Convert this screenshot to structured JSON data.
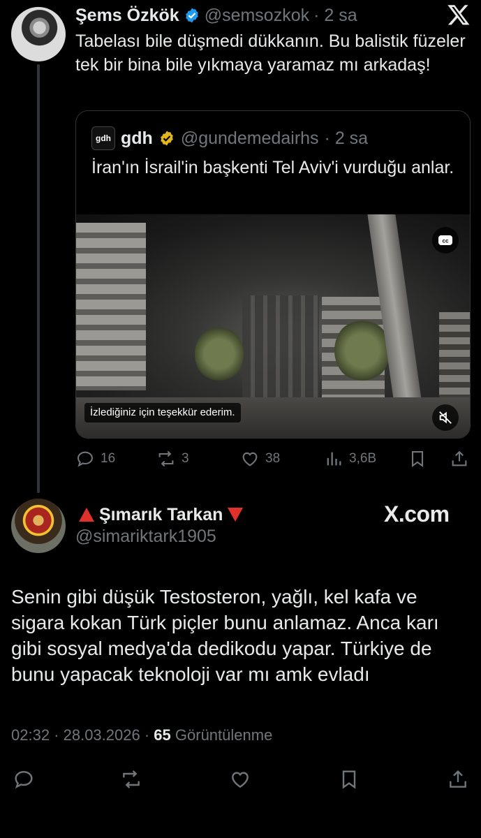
{
  "tweet1": {
    "name": "Şems Özkök",
    "handle": "@semsozkok",
    "time": "· 2 sa",
    "text": "Tabelası bile düşmedi dükkanın. Bu balistik füzeler tek bir bina bile yıkmaya yaramaz mı arkadaş!",
    "quote": {
      "logo_text": "gdh",
      "name": "gdh",
      "handle": "@gundemedairhs",
      "time": "· 2 sa",
      "text": "İran'ın İsrail'in başkenti Tel Aviv'i vurduğu anlar.",
      "video": {
        "caption": "İzlediğiniz için teşekkür ederim.",
        "cc_icon": "closed-captions-icon",
        "mute_icon": "muted-speaker-icon"
      }
    },
    "actions": {
      "replies": "16",
      "reposts": "3",
      "likes": "38",
      "views": "3,6B"
    }
  },
  "tweet2": {
    "name": "Şımarık Tarkan",
    "handle": "@simariktark1905",
    "watermark": "X.com",
    "text": "Senin gibi düşük Testosteron, yağlı, kel kafa ve sigara kokan Türk piçler bunu anlamaz. Anca karı gibi sosyal medya'da dedikodu yapar. Türkiye de bunu yapacak teknoloji var mı amk evladı",
    "timestamp": "02:32 · 28.03.2026 ·",
    "views_count": "65",
    "views_label": "Görüntülenme"
  },
  "colors": {
    "background": "#000000",
    "text": "#e7e9ea",
    "muted": "#71767b",
    "border": "#2f3336",
    "verified_blue": "#1d9bf0",
    "verified_gold": "#e2b719",
    "flag_red": "#e0312b"
  }
}
